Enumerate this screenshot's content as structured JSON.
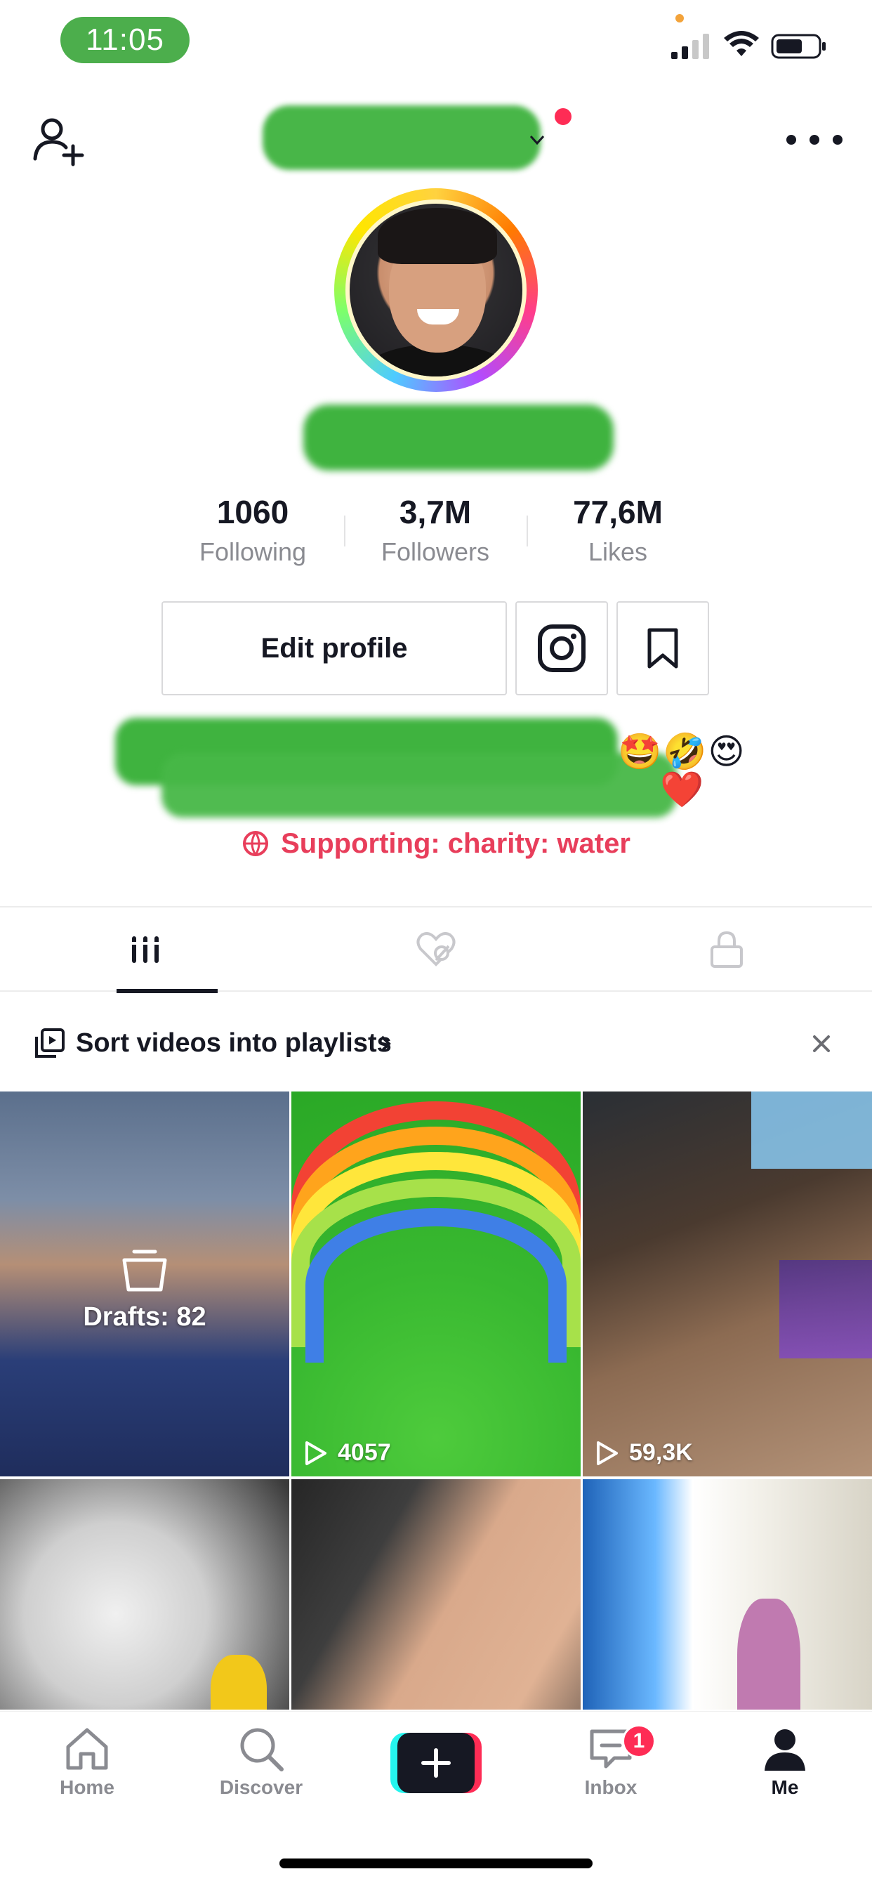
{
  "status_bar": {
    "time": "11:05"
  },
  "profile": {
    "stats": [
      {
        "value": "1060",
        "label": "Following"
      },
      {
        "value": "3,7M",
        "label": "Followers"
      },
      {
        "value": "77,6M",
        "label": "Likes"
      }
    ],
    "edit_profile_label": "Edit profile",
    "bio_emojis_line1": "🤩🤣😍",
    "bio_emojis_line2": "❤️",
    "charity_text": "Supporting: charity: water"
  },
  "tabs": [
    {
      "name": "videos",
      "icon": "grid-icon",
      "active": true
    },
    {
      "name": "liked",
      "icon": "liked-hidden-icon",
      "active": false
    },
    {
      "name": "private",
      "icon": "lock-icon",
      "active": false
    }
  ],
  "playlist_banner": {
    "text": "Sort videos into playlists"
  },
  "videos": [
    {
      "type": "drafts",
      "label": "Drafts: 82"
    },
    {
      "type": "video",
      "views": "4057"
    },
    {
      "type": "video",
      "views": "59,3K"
    },
    {
      "type": "video",
      "views": ""
    },
    {
      "type": "video",
      "views": ""
    },
    {
      "type": "video",
      "views": ""
    }
  ],
  "bottom_nav": {
    "items": [
      {
        "label": "Home",
        "icon": "home-icon"
      },
      {
        "label": "Discover",
        "icon": "search-icon"
      },
      {
        "label": "",
        "icon": "create-plus-icon"
      },
      {
        "label": "Inbox",
        "icon": "inbox-icon",
        "badge": "1"
      },
      {
        "label": "Me",
        "icon": "profile-icon",
        "active": true
      }
    ]
  },
  "colors": {
    "accent": "#fe2c55",
    "charity": "#e83e5b",
    "cyan": "#25f4ee",
    "redaction": "#3fb33f"
  }
}
